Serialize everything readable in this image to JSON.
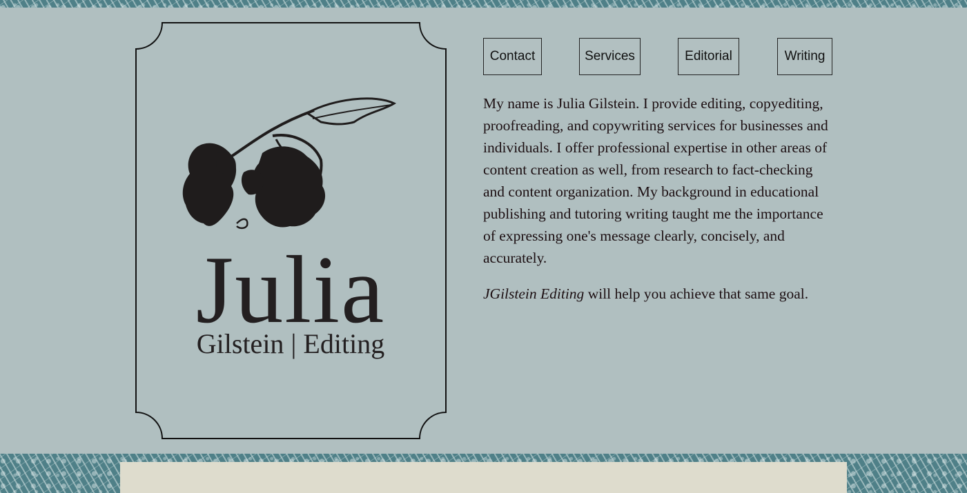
{
  "nav": {
    "items": [
      {
        "label": "Contact"
      },
      {
        "label": "Services"
      },
      {
        "label": "Editorial"
      },
      {
        "label": "Writing"
      }
    ]
  },
  "logo": {
    "first_name": "Julia",
    "subtitle": "Gilstein | Editing"
  },
  "intro": {
    "paragraph1": "My name is Julia Gilstein. I provide editing, copyediting, proofreading, and copywriting services for businesses and individuals. I offer professional expertise in other areas of content creation as well, from research to fact-checking and content organization. My background in educational publishing and tutoring writing taught me the importance of expressing one's message clearly, concisely, and accurately.",
    "paragraph2_brand": "JGilstein Editing",
    "paragraph2_rest": " will help you achieve that same goal."
  },
  "colors": {
    "background": "#b0bfc0",
    "pattern_teal": "#4f8088",
    "footer_panel": "#dedccd",
    "text": "#1c0f12"
  }
}
